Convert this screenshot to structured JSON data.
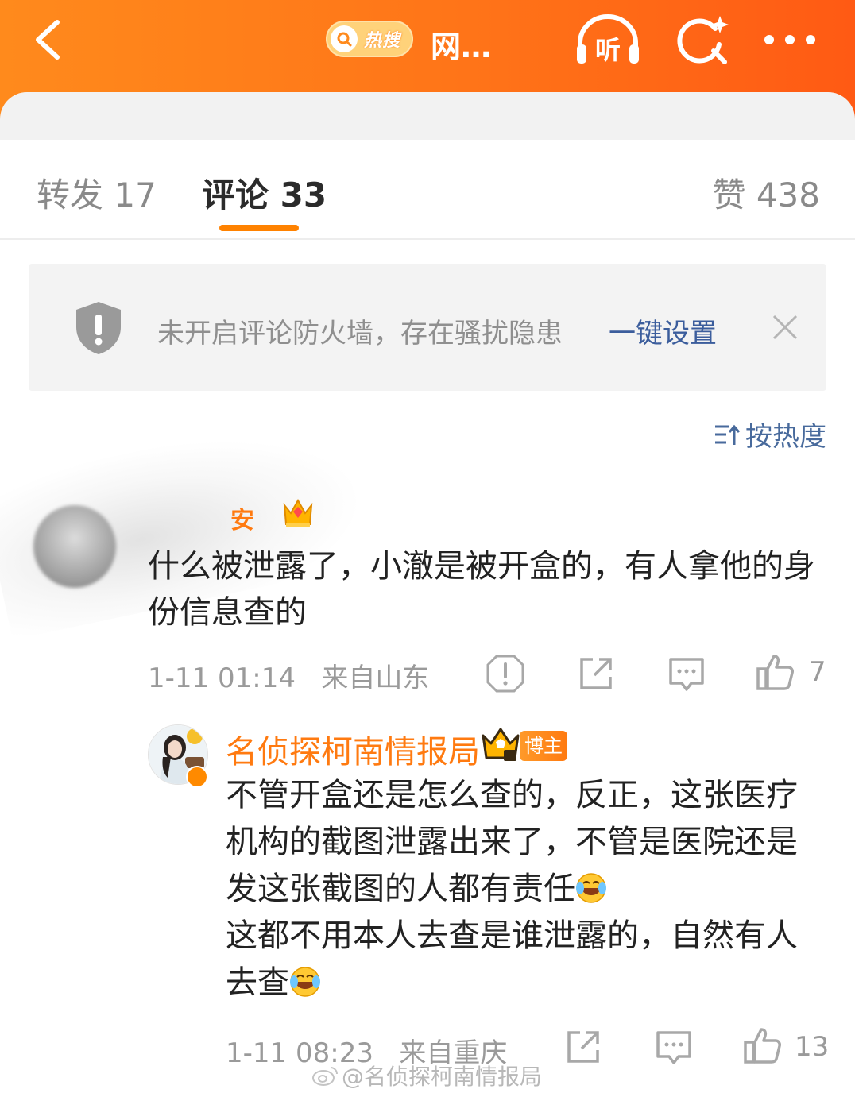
{
  "header": {
    "hot_label": "热搜",
    "title": "网…",
    "listen_label": "听"
  },
  "tabs": {
    "repost": "转发 17",
    "comment": "评论 33",
    "like": "赞 438"
  },
  "notice": {
    "message": "未开启评论防火墙，存在骚扰隐患",
    "action": "一键设置"
  },
  "sort": {
    "label": "按热度"
  },
  "comment": {
    "name_fragment": "安",
    "body": "什么被泄露了，小澈是被开盒的，有人拿他的身份信息查的",
    "time": "1-11 01:14",
    "location": "来自山东",
    "likes": "7"
  },
  "reply": {
    "name": "名侦探柯南情报局",
    "badge": "博主",
    "body_part1": "不管开盒还是怎么查的，反正，这张医疗机构的截图泄露出来了，不管是医院还是发这张截图的人都有责任",
    "body_part2": "这都不用本人去查是谁泄露的，自然有人去查",
    "time": "1-11 08:23",
    "location": "来自重庆",
    "likes": "13"
  },
  "watermark": "@名侦探柯南情报局",
  "colors": {
    "header_orange": "#ff7418",
    "accent_orange": "#ff8200",
    "link_blue": "#3b5d9c",
    "name_orange": "#ff7a10"
  }
}
